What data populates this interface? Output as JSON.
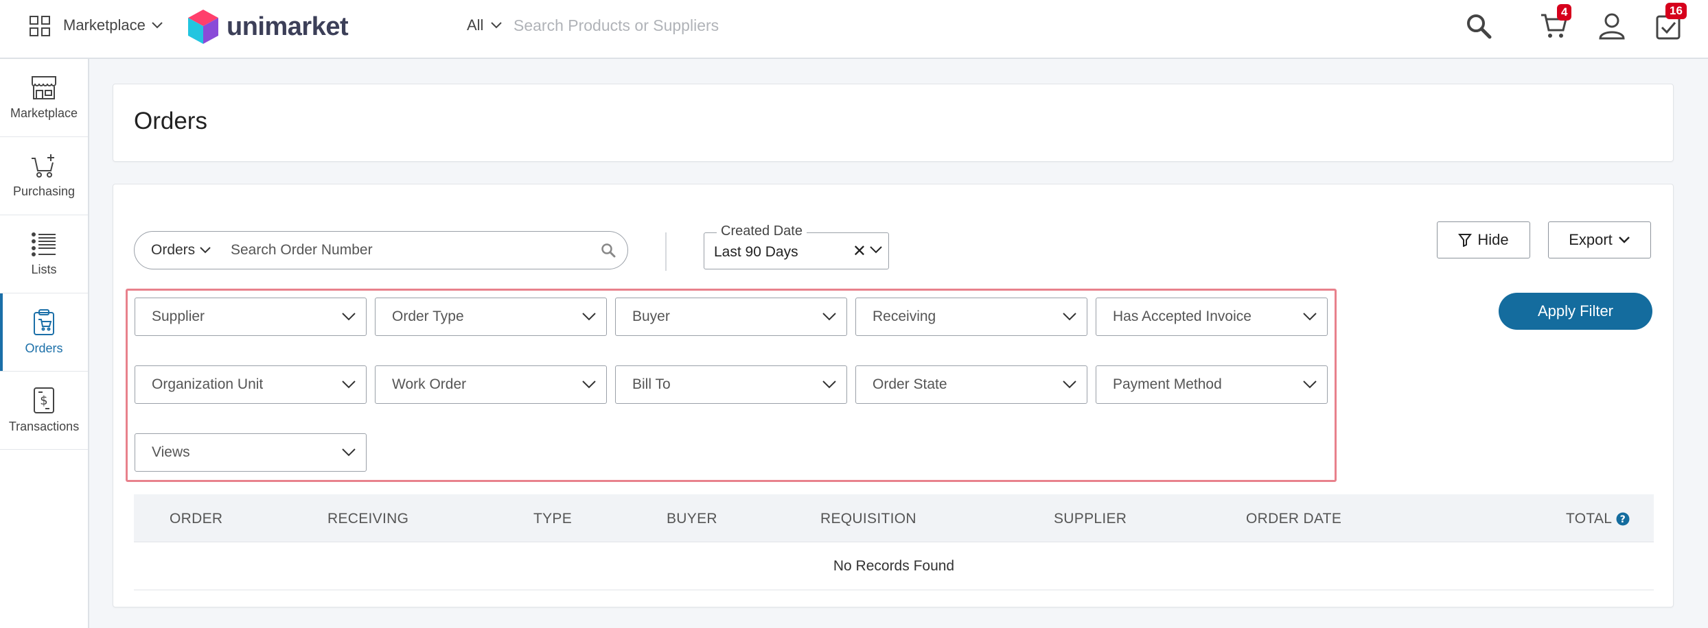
{
  "topbar": {
    "marketplace_label": "Marketplace",
    "logo_text": "unimarket",
    "search_scope": "All",
    "search_placeholder": "Search Products or Suppliers",
    "cart_count": "4",
    "tasks_count": "16"
  },
  "sidebar": {
    "items": [
      {
        "label": "Marketplace",
        "icon": "storefront-icon"
      },
      {
        "label": "Purchasing",
        "icon": "cart-add-icon"
      },
      {
        "label": "Lists",
        "icon": "list-icon"
      },
      {
        "label": "Orders",
        "icon": "clipboard-icon",
        "active": true
      },
      {
        "label": "Transactions",
        "icon": "receipt-dollar-icon"
      }
    ]
  },
  "page": {
    "title": "Orders"
  },
  "search": {
    "type_label": "Orders",
    "placeholder": "Search Order Number"
  },
  "date_filter": {
    "legend": "Created Date",
    "value": "Last 90 Days",
    "clear": "✕"
  },
  "buttons": {
    "hide": "Hide",
    "export": "Export",
    "apply": "Apply Filter"
  },
  "filters": [
    "Supplier",
    "Order Type",
    "Buyer",
    "Receiving",
    "Has Accepted Invoice",
    "Organization Unit",
    "Work Order",
    "Bill To",
    "Order State",
    "Payment Method",
    "Views"
  ],
  "table": {
    "columns": [
      "ORDER",
      "RECEIVING",
      "TYPE",
      "BUYER",
      "REQUISITION",
      "SUPPLIER",
      "ORDER DATE",
      "TOTAL"
    ],
    "empty_message": "No Records Found"
  },
  "colors": {
    "accent": "#146c9e",
    "badge": "#d6001c",
    "highlight": "#e8818c"
  }
}
